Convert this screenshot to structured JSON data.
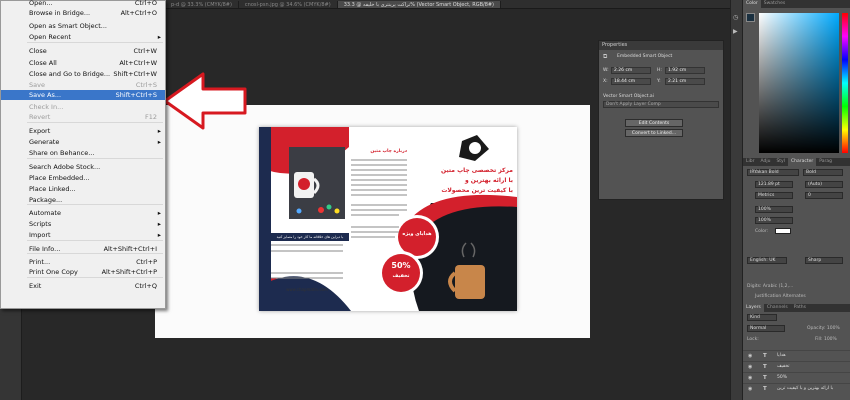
{
  "menu": {
    "items": [
      {
        "label": "Open...",
        "shortcut": "Ctrl+O",
        "state": "normal"
      },
      {
        "label": "Browse in Bridge...",
        "shortcut": "Alt+Ctrl+O",
        "state": "normal"
      },
      {
        "label": "Open as Smart Object...",
        "shortcut": "",
        "state": "normal"
      },
      {
        "label": "Open Recent",
        "shortcut": "",
        "state": "submenu"
      },
      {
        "label": "Close",
        "shortcut": "Ctrl+W",
        "state": "normal"
      },
      {
        "label": "Close All",
        "shortcut": "Alt+Ctrl+W",
        "state": "normal"
      },
      {
        "label": "Close and Go to Bridge...",
        "shortcut": "Shift+Ctrl+W",
        "state": "normal"
      },
      {
        "label": "Save",
        "shortcut": "Ctrl+S",
        "state": "disabled"
      },
      {
        "label": "Save As...",
        "shortcut": "Shift+Ctrl+S",
        "state": "highlighted"
      },
      {
        "label": "Check In...",
        "shortcut": "",
        "state": "disabled"
      },
      {
        "label": "Revert",
        "shortcut": "F12",
        "state": "disabled"
      },
      {
        "label": "Export",
        "shortcut": "",
        "state": "submenu"
      },
      {
        "label": "Generate",
        "shortcut": "",
        "state": "submenu"
      },
      {
        "label": "Share on Behance...",
        "shortcut": "",
        "state": "normal"
      },
      {
        "label": "Search Adobe Stock...",
        "shortcut": "",
        "state": "normal"
      },
      {
        "label": "Place Embedded...",
        "shortcut": "",
        "state": "normal"
      },
      {
        "label": "Place Linked...",
        "shortcut": "",
        "state": "normal"
      },
      {
        "label": "Package...",
        "shortcut": "",
        "state": "normal"
      },
      {
        "label": "Automate",
        "shortcut": "",
        "state": "submenu"
      },
      {
        "label": "Scripts",
        "shortcut": "",
        "state": "submenu"
      },
      {
        "label": "Import",
        "shortcut": "",
        "state": "submenu"
      },
      {
        "label": "File Info...",
        "shortcut": "Alt+Shift+Ctrl+I",
        "state": "normal"
      },
      {
        "label": "Print...",
        "shortcut": "Ctrl+P",
        "state": "normal"
      },
      {
        "label": "Print One Copy",
        "shortcut": "Alt+Shift+Ctrl+P",
        "state": "normal"
      },
      {
        "label": "Exit",
        "shortcut": "Ctrl+Q",
        "state": "normal"
      }
    ]
  },
  "doc_tabs": [
    "p-d @ 33.3% (CMYK/8#)",
    "cnosl-psn.jpg @ 34.6% (CMYK/8#)",
    "تراکت پرینتری با خلیفه @ 33.3% (Vector Smart Object, RGB/8#)"
  ],
  "properties": {
    "title": "Properties",
    "type": "Embedded Smart Object",
    "w": "2.26 cm",
    "h": "1.92 cm",
    "x": "18.44 cm",
    "y": "2.21 cm",
    "source": "Vector Smart Object.ai",
    "comp": "Don't Apply Layer Comp",
    "edit_btn": "Edit Contents",
    "convert_btn": "Convert to Linked..."
  },
  "right_panel": {
    "color_tabs": [
      "Color",
      "Swatches"
    ],
    "char_tabs": [
      "Libr",
      "Adju",
      "Styl",
      "Character",
      "Parag"
    ],
    "font": "IRYakan Bold",
    "style": "Bold",
    "size": "121.89 pt",
    "leading": "(Auto)",
    "tracking_label": "Metrics",
    "tracking": "0",
    "scale_v": "100%",
    "scale_h": "100%",
    "color_label": "Color:",
    "language": "English: UK",
    "aa": "Sharp",
    "digits": "Digits: Arabic (1,2,...",
    "justify": "Justification Alternates",
    "layers_tabs": [
      "Layers",
      "Channels",
      "Paths"
    ],
    "kind": "Kind",
    "blend": "Normal",
    "opacity": "Opacity: 100%",
    "lock": "Lock:",
    "fill": "Fill: 100%",
    "layers": [
      "هدایا",
      "تخفیف",
      "50%",
      "با ارائه بهترین و با کیفیت ترین"
    ]
  },
  "brochure": {
    "heading": "مرکز تخصصی چاپ متین",
    "sub1": "با ارائه بهترین و",
    "sub2": "با کیفیت ترین محصولات",
    "percent": "50%",
    "off": "تخفیف",
    "gift": "هدایای ویژه",
    "tagline": "با دیزاین های خلاقانه ما کار خود را متمایز کنید",
    "website": "www.chapmatin.com",
    "body_title": "درباره چاپ متین"
  },
  "colors": {
    "highlight": "#3a76c9",
    "red": "#d3202c",
    "navy": "#1d2b4f",
    "arrow": "#d71920"
  }
}
